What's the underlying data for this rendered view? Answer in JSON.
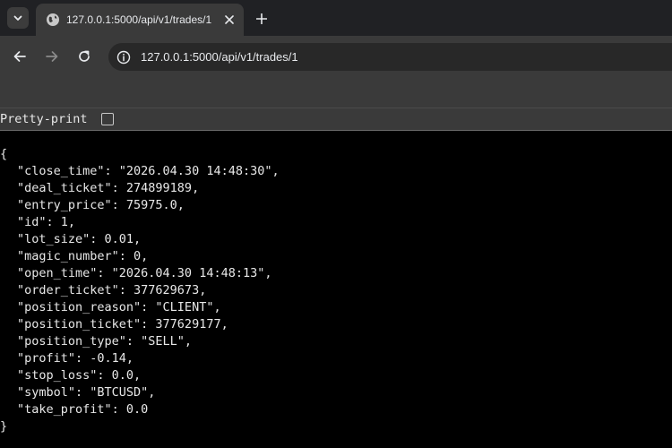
{
  "tab": {
    "title": "127.0.0.1:5000/api/v1/trades/1",
    "favicon_icon": "globe-icon",
    "close_icon": "close-icon"
  },
  "tabstrip": {
    "search_icon": "chevron-down-icon",
    "new_tab_icon": "plus-icon"
  },
  "toolbar": {
    "back_icon": "arrow-left-icon",
    "forward_icon": "arrow-right-icon",
    "reload_icon": "reload-icon",
    "site_info_icon": "site-info-icon",
    "url": "127.0.0.1:5000/api/v1/trades/1"
  },
  "pretty_print": {
    "label": "Pretty-print",
    "checked": false
  },
  "json_lines": [
    "{",
    "\"close_time\": \"2026.04.30 14:48:30\",",
    "\"deal_ticket\": 274899189,",
    "\"entry_price\": 75975.0,",
    "\"id\": 1,",
    "\"lot_size\": 0.01,",
    "\"magic_number\": 0,",
    "\"open_time\": \"2026.04.30 14:48:13\",",
    "\"order_ticket\": 377629673,",
    "\"position_reason\": \"CLIENT\",",
    "\"position_ticket\": 377629177,",
    "\"position_type\": \"SELL\",",
    "\"profit\": -0.14,",
    "\"stop_loss\": 0.0,",
    "\"symbol\": \"BTCUSD\",",
    "\"take_profit\": 0.0",
    "}"
  ],
  "colors": {
    "tabstrip_bg": "#202124",
    "toolbar_bg": "#3a3a3a",
    "omnibox_bg": "#282828",
    "page_bg": "#000000",
    "text": "#e8e8e8"
  }
}
